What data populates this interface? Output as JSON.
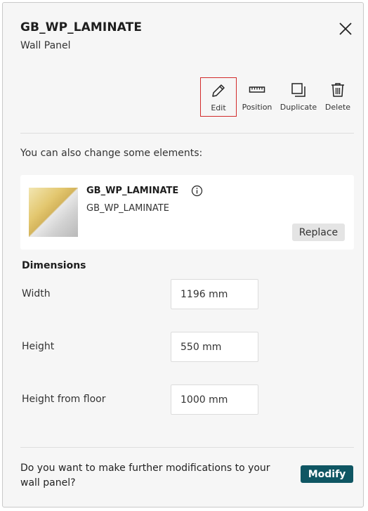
{
  "header": {
    "title": "GB_WP_LAMINATE",
    "subtitle": "Wall Panel"
  },
  "toolbar": {
    "edit_label": "Edit",
    "position_label": "Position",
    "duplicate_label": "Duplicate",
    "delete_label": "Delete"
  },
  "hint_text": "You can also change some elements:",
  "material": {
    "name": "GB_WP_LAMINATE",
    "sub": "GB_WP_LAMINATE",
    "replace_label": "Replace"
  },
  "dimensions": {
    "title": "Dimensions",
    "width_label": "Width",
    "width_value": "1196 mm",
    "height_label": "Height",
    "height_value": "550 mm",
    "floor_label": "Height from floor",
    "floor_value": "1000 mm"
  },
  "footer": {
    "question": "Do you want to make further modifications to your wall panel?",
    "modify_label": "Modify"
  },
  "colors": {
    "accent": "#0f5663",
    "selected_border": "#d22b2b",
    "panel_bg": "#f6f6f6"
  }
}
